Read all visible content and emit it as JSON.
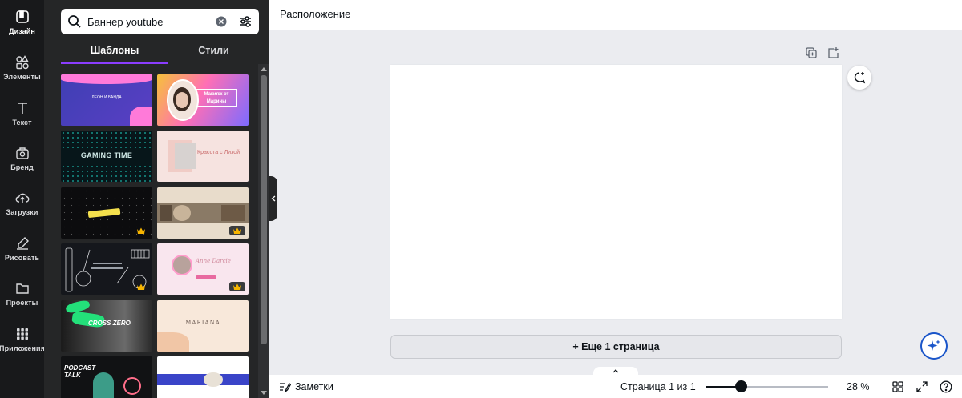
{
  "sidebar": {
    "items": [
      {
        "label": "Дизайн",
        "icon": "design-icon"
      },
      {
        "label": "Элементы",
        "icon": "elements-icon"
      },
      {
        "label": "Текст",
        "icon": "text-icon"
      },
      {
        "label": "Бренд",
        "icon": "brand-icon"
      },
      {
        "label": "Загрузки",
        "icon": "upload-icon"
      },
      {
        "label": "Рисовать",
        "icon": "draw-icon"
      },
      {
        "label": "Проекты",
        "icon": "folder-icon"
      },
      {
        "label": "Приложения",
        "icon": "apps-icon"
      }
    ]
  },
  "panel": {
    "search": {
      "value": "Баннер youtube"
    },
    "tabs": [
      {
        "label": "Шаблоны"
      },
      {
        "label": "Стили"
      }
    ],
    "templates": [
      {
        "title": "ЛЕОН И БАНДА",
        "premium": false
      },
      {
        "title": "Макияж от Марины",
        "premium": false
      },
      {
        "title": "GAMING TIME",
        "premium": false
      },
      {
        "title": "Красота с Лизой",
        "premium": false
      },
      {
        "title": "",
        "premium": true
      },
      {
        "title": "",
        "premium": true
      },
      {
        "title": "",
        "premium": true
      },
      {
        "title": "Anne Darcie",
        "premium": true
      },
      {
        "title": "CROSS ZERO",
        "premium": false
      },
      {
        "title": "MARIANA",
        "premium": false
      },
      {
        "title": "PODCAST TALK",
        "premium": false
      },
      {
        "title": "",
        "premium": false
      }
    ]
  },
  "header": {
    "title": "Расположение"
  },
  "canvas": {
    "add_page_label": "+ Еще 1 страница"
  },
  "footer": {
    "notes_label": "Заметки",
    "page_info": "Страница 1 из 1",
    "zoom_label": "28 %",
    "zoom_fraction": 0.28
  },
  "colors": {
    "accent": "#8b3dff",
    "rail_bg": "#18191b",
    "panel_bg": "#252627",
    "canvas_bg": "#ebecf0",
    "crown": "#f7b500",
    "magic": "#1a55c9"
  }
}
